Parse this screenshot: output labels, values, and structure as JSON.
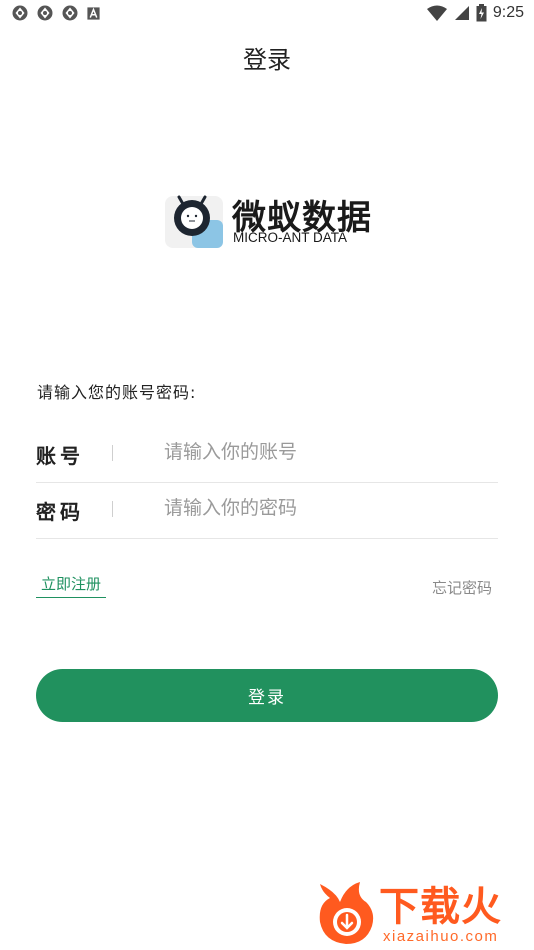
{
  "status_bar": {
    "time": "9:25",
    "left_icons": [
      "sync-icon",
      "sync-icon",
      "sync-icon",
      "a-box-icon"
    ],
    "right_icons": [
      "wifi-icon",
      "signal-icon",
      "battery-icon"
    ]
  },
  "page": {
    "title": "登录"
  },
  "logo": {
    "name_cn": "微蚁数据",
    "name_en": "MICRO-ANT DATA"
  },
  "form": {
    "prompt": "请输入您的账号密码:",
    "account": {
      "label": "账号",
      "value": "",
      "placeholder": "请输入你的账号"
    },
    "password": {
      "label": "密码",
      "value": "",
      "placeholder": "请输入你的密码"
    },
    "register_label": "立即注册",
    "forgot_label": "忘记密码",
    "login_label": "登录"
  },
  "watermark": {
    "text": "下载火",
    "sub": "xiazaihuo.com"
  },
  "colors": {
    "accent": "#21915e",
    "watermark": "#ff5a1f"
  }
}
